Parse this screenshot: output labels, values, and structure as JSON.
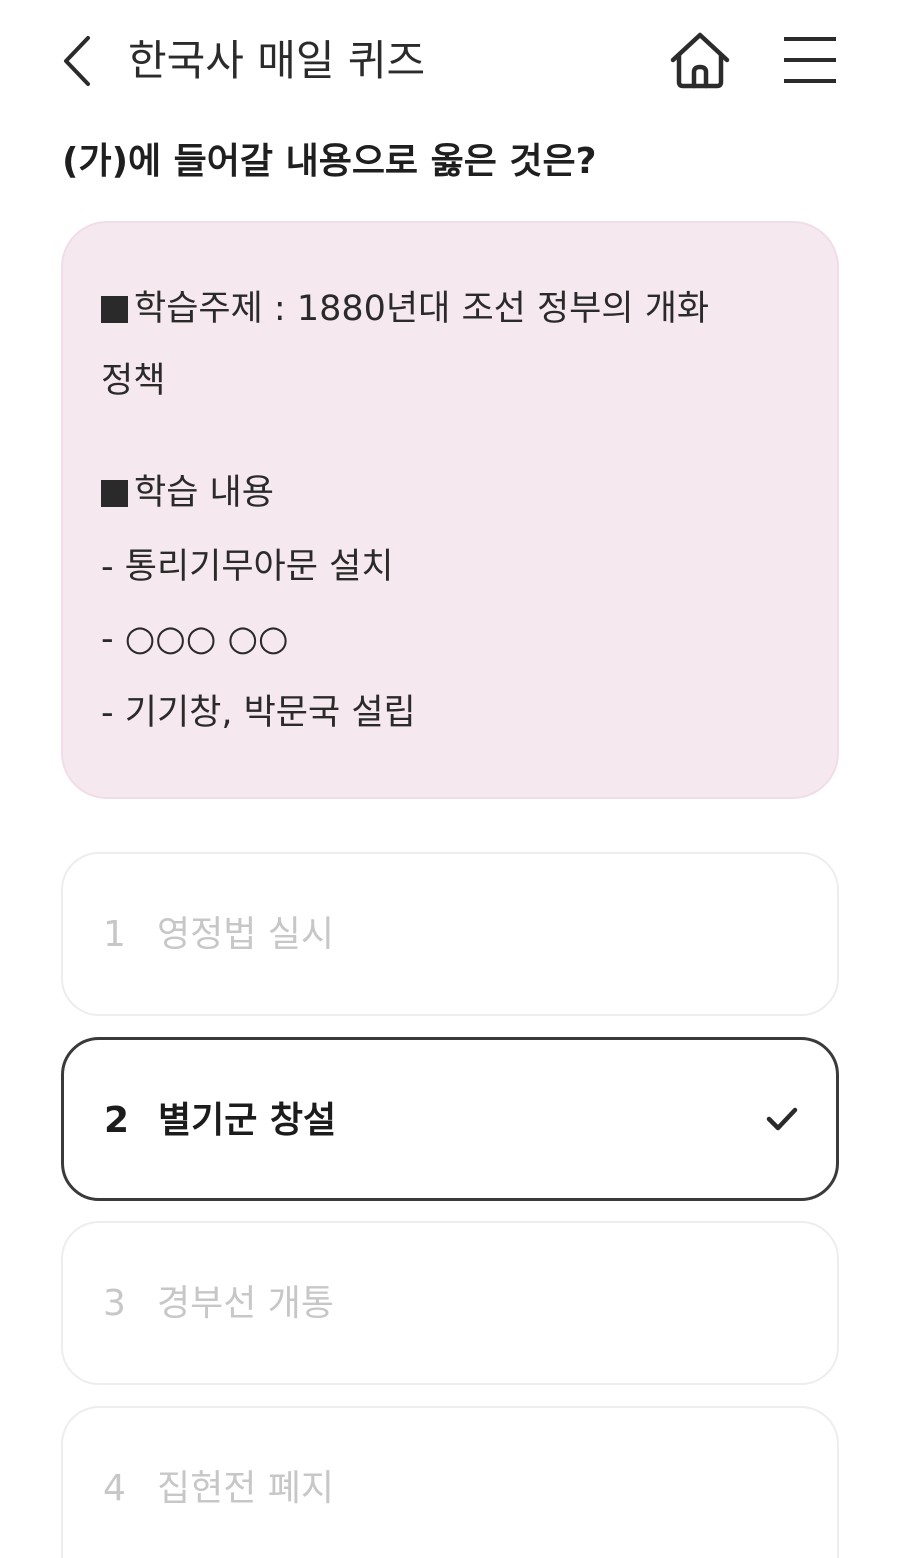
{
  "header": {
    "title": "한국사 매일 퀴즈",
    "back_icon": "chevron-left-icon",
    "home_icon": "home-icon",
    "menu_icon": "hamburger-menu-icon"
  },
  "question": "(가)에 들어갈 내용으로 옳은 것은?",
  "passage": {
    "topic_line1": "학습주제 : 1880년대 조선 정부의 개화",
    "topic_line2": "정책",
    "content_heading": "학습 내용",
    "items": [
      "- 통리기무아문 설치",
      "- ○○○  ○○",
      "- 기기창, 박문국 설립"
    ],
    "background_color": "#f6e8ef"
  },
  "options": [
    {
      "number": "1",
      "label": "영정법 실시",
      "selected": false
    },
    {
      "number": "2",
      "label": "별기군 창설",
      "selected": true
    },
    {
      "number": "3",
      "label": "경부선 개통",
      "selected": false
    },
    {
      "number": "4",
      "label": "집현전 폐지",
      "selected": false
    }
  ],
  "colors": {
    "selected_border": "#3a3a3a",
    "unselected_text": "#c7c7c7",
    "selected_text": "#1c1c1c"
  }
}
